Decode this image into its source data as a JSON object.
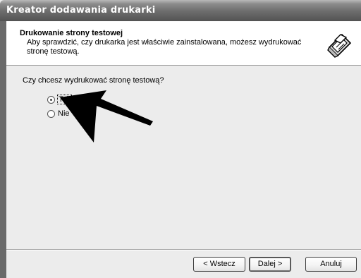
{
  "window": {
    "title": "Kreator dodawania drukarki"
  },
  "header": {
    "title": "Drukowanie strony testowej",
    "subtitle": "Aby sprawdzić, czy drukarka jest właściwie zainstalowana, możesz wydrukować stronę testową.",
    "icon": "printer-icon"
  },
  "main": {
    "question": "Czy chcesz wydrukować stronę testową?",
    "options": [
      {
        "label": "Tak",
        "selected": true
      },
      {
        "label": "Nie",
        "selected": false
      }
    ]
  },
  "footer": {
    "back_label": "< Wstecz",
    "next_label": "Dalej >",
    "cancel_label": "Anuluj"
  },
  "colors": {
    "titlebar": "#6f6f6f",
    "arrow": "#000000",
    "panel": "#ececec"
  }
}
